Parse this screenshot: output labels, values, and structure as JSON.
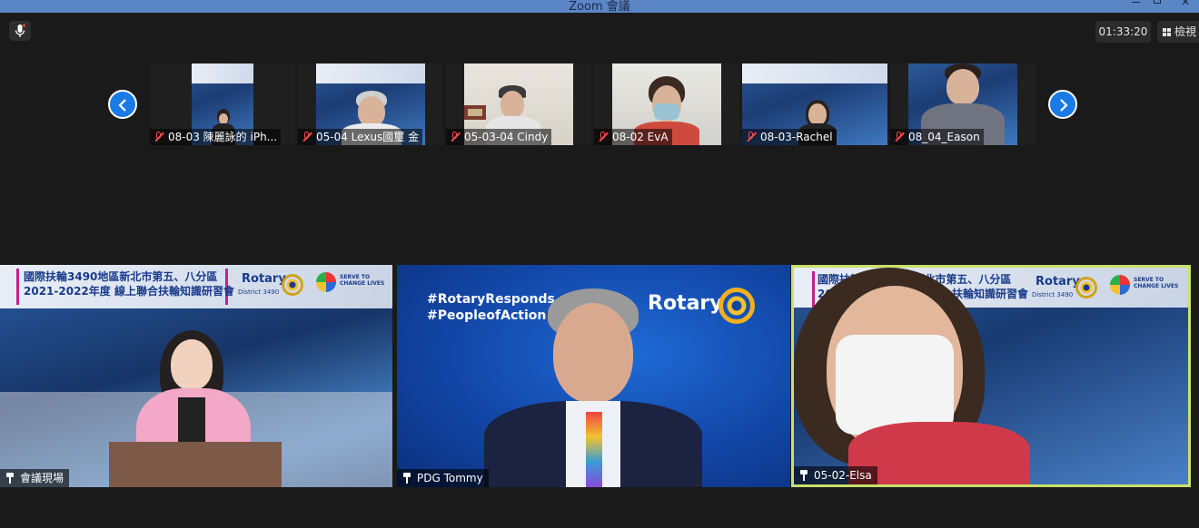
{
  "window": {
    "title": "Zoom 會議"
  },
  "toolbar": {
    "timer": "01:33:20",
    "view_label": "檢視"
  },
  "filmstrip": [
    {
      "name": "08-03 陳麗詠的 iPh..."
    },
    {
      "name": "05-04 Lexus國璽 金"
    },
    {
      "name": "05-03-04 Cindy"
    },
    {
      "name": "08-02 EvA"
    },
    {
      "name": "08-03-Rachel"
    },
    {
      "name": "08_04_Eason"
    }
  ],
  "tiles": [
    {
      "name": "會議現場"
    },
    {
      "name": "PDG Tommy"
    },
    {
      "name": "05-02-Elsa"
    }
  ],
  "event_banner": {
    "line1": "國際扶輪3490地區新北市第五、八分區",
    "line2": "2021-2022年度 線上聯合扶輪知識研習會",
    "rotary": "Rotary",
    "district": "District 3490",
    "serve_1": "SERVE TO",
    "serve_2": "CHANGE LIVES"
  },
  "tommy_bg": {
    "hashtag1": "#RotaryResponds",
    "hashtag2": "#PeopleofAction",
    "rotary": "Rotary"
  },
  "colors": {
    "accent": "#1a7ae6",
    "active_speaker_border": "#c9e06a",
    "muted": "#ff4a4a",
    "titlebar": "#5b86c6"
  }
}
